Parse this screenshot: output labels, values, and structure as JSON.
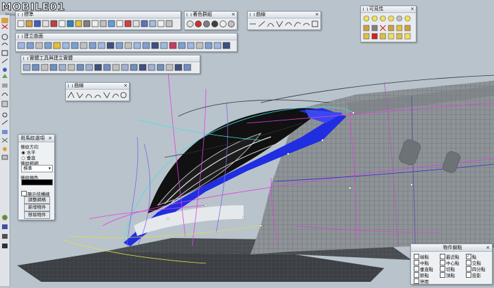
{
  "watermark": {
    "logo": "MOBILE01",
    "sub": "Rhino Flyer"
  },
  "toolbars": {
    "standard": {
      "title": "標準"
    },
    "display": {
      "title": "著色群組"
    },
    "curve": {
      "title": "曲線"
    },
    "visibility": {
      "title": "可見性"
    },
    "surface": {
      "title": "建立曲面"
    },
    "solid": {
      "title": "實體工具與建立實體"
    },
    "polygon": {
      "title": "曲線"
    }
  },
  "curvature_panel": {
    "title": "斑馬紋選項",
    "direction_label": "條紋方向",
    "option_horizontal": "水平",
    "option_vertical": "垂直",
    "thickness_label": "條紋粗細",
    "thickness_value": "標準",
    "color_label": "條紋顏色",
    "show_isocurves": "顯示結構線",
    "adjust_mesh": "調整網格",
    "add_object": "新增物件",
    "remove_object": "移除物件"
  },
  "osnap_panel": {
    "title": "物件鎖點",
    "items": [
      {
        "label": "端點",
        "checked": false
      },
      {
        "label": "最近點",
        "checked": false
      },
      {
        "label": "點",
        "checked": true
      },
      {
        "label": "中點",
        "checked": false
      },
      {
        "label": "中心點",
        "checked": false
      },
      {
        "label": "交點",
        "checked": false
      },
      {
        "label": "垂直點",
        "checked": false
      },
      {
        "label": "切點",
        "checked": false
      },
      {
        "label": "四分點",
        "checked": false
      },
      {
        "label": "節點",
        "checked": false
      },
      {
        "label": "頂點",
        "checked": false
      },
      {
        "label": "投影",
        "checked": false
      },
      {
        "label": "停用",
        "checked": false
      }
    ]
  },
  "colors": {
    "background": "#b9c3cc",
    "zebra_blue": "#1f2ee0",
    "curve_magenta": "#e040e0",
    "curve_cyan": "#40e0e0"
  }
}
